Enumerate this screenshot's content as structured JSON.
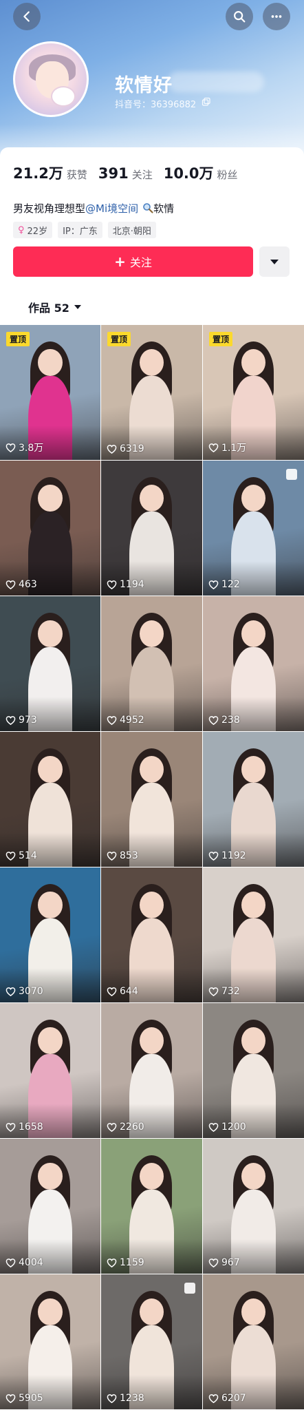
{
  "header": {
    "back_icon": "chevron-left-icon",
    "search_icon": "search-icon",
    "more_icon": "more-horizontal-icon"
  },
  "profile": {
    "username": "软情好",
    "douyin_id": "抖音号：36396882",
    "stats": [
      {
        "num": "21.2万",
        "label": "获赞"
      },
      {
        "num": "391",
        "label": "关注"
      },
      {
        "num": "10.0万",
        "label": "粉丝"
      }
    ],
    "bio_prefix": "男友视角理想型",
    "bio_mention": "@Mi境空间",
    "bio_suffix": "软情",
    "tags": {
      "age": "22岁",
      "ip": "IP：广东",
      "location": "北京·朝阳"
    },
    "follow_label": "关注",
    "follow_plus": "+"
  },
  "tabs": {
    "works_label": "作品 52"
  },
  "grid": {
    "pin_label": "置顶",
    "items": [
      {
        "likes": "3.8万",
        "pinned": true,
        "bg": "#8fa3b8",
        "cloth": "#e0338f"
      },
      {
        "likes": "6319",
        "pinned": true,
        "bg": "#c9b8a8",
        "cloth": "#ecdcd2"
      },
      {
        "likes": "1.1万",
        "pinned": true,
        "bg": "#d8c6b6",
        "cloth": "#f1d4cc"
      },
      {
        "likes": "463",
        "pinned": false,
        "bg": "#7a5c52",
        "cloth": "#2b2225"
      },
      {
        "likes": "1194",
        "pinned": false,
        "bg": "#3e3a3c",
        "cloth": "#e9e4e0"
      },
      {
        "likes": "122",
        "pinned": false,
        "bg": "#6e8aa6",
        "cloth": "#d9e2ec",
        "multi": true
      },
      {
        "likes": "973",
        "pinned": false,
        "bg": "#3f4c52",
        "cloth": "#f2efee"
      },
      {
        "likes": "4952",
        "pinned": false,
        "bg": "#b8a496",
        "cloth": "#d2c0b3"
      },
      {
        "likes": "238",
        "pinned": false,
        "bg": "#c7b2a8",
        "cloth": "#f3e6e1"
      },
      {
        "likes": "514",
        "pinned": false,
        "bg": "#4a3b34",
        "cloth": "#efe2d8"
      },
      {
        "likes": "853",
        "pinned": false,
        "bg": "#9a8678",
        "cloth": "#f1e4da"
      },
      {
        "likes": "1192",
        "pinned": false,
        "bg": "#a2acb4",
        "cloth": "#e9d8cf"
      },
      {
        "likes": "3070",
        "pinned": false,
        "bg": "#2f6e9c",
        "cloth": "#f2efe9"
      },
      {
        "likes": "644",
        "pinned": false,
        "bg": "#5a4a42",
        "cloth": "#eed9cd"
      },
      {
        "likes": "732",
        "pinned": false,
        "bg": "#d8d0ca",
        "cloth": "#ecd8cf"
      },
      {
        "likes": "1658",
        "pinned": false,
        "bg": "#cfc6c2",
        "cloth": "#e8a9c0"
      },
      {
        "likes": "2260",
        "pinned": false,
        "bg": "#b9aba3",
        "cloth": "#f1ece8"
      },
      {
        "likes": "1200",
        "pinned": false,
        "bg": "#8c8782",
        "cloth": "#f0e7e0"
      },
      {
        "likes": "4004",
        "pinned": false,
        "bg": "#a69c98",
        "cloth": "#f3f1ef"
      },
      {
        "likes": "1159",
        "pinned": false,
        "bg": "#8aa178",
        "cloth": "#f0e8e0"
      },
      {
        "likes": "967",
        "pinned": false,
        "bg": "#cfc9c4",
        "cloth": "#f1ebe7"
      },
      {
        "likes": "5905",
        "pinned": false,
        "bg": "#c0b2a8",
        "cloth": "#f5efea"
      },
      {
        "likes": "1238",
        "pinned": false,
        "bg": "#6d6a68",
        "cloth": "#f0e4da",
        "multi": true
      },
      {
        "likes": "6207",
        "pinned": false,
        "bg": "#a8988c",
        "cloth": "#ecddd4"
      }
    ]
  },
  "colors": {
    "follow": "#fe2c55",
    "mention": "#2b5ea8",
    "pin": "#fbd92d"
  }
}
